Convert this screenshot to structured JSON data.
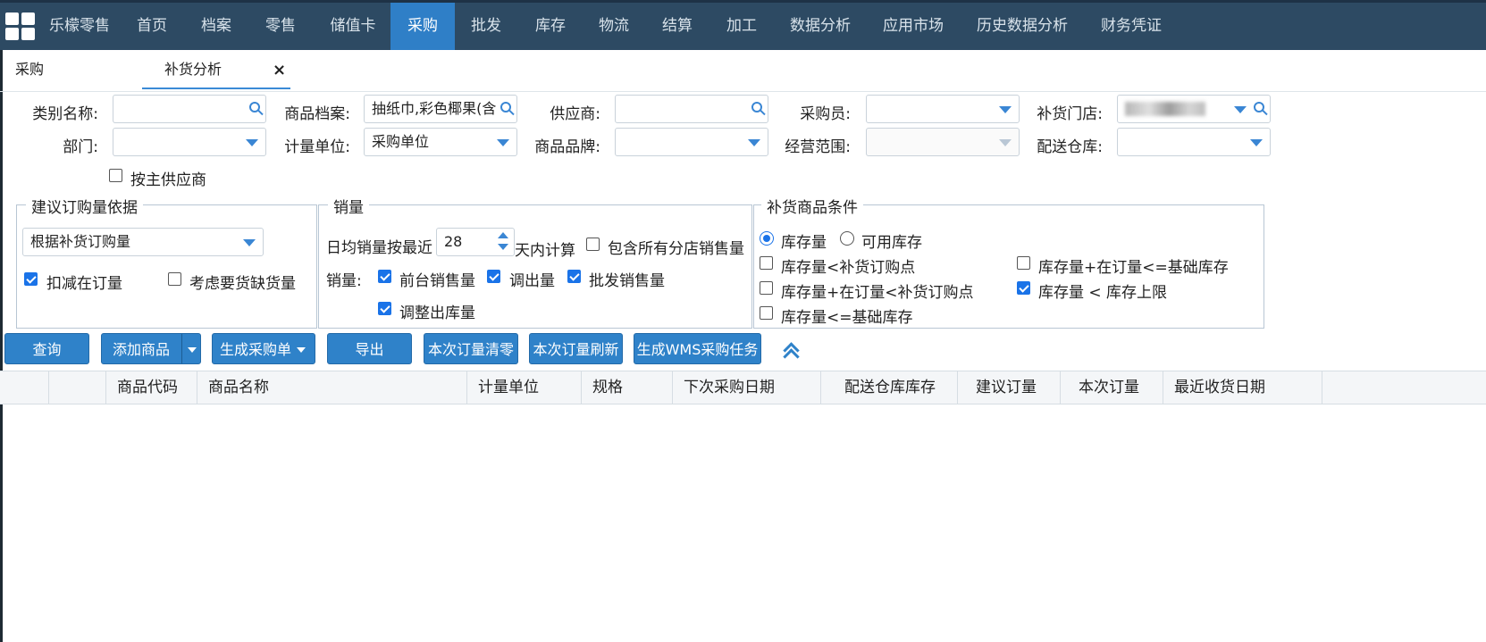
{
  "nav": {
    "brand": "乐檬零售",
    "items": [
      "首页",
      "档案",
      "零售",
      "储值卡",
      "采购",
      "批发",
      "库存",
      "物流",
      "结算",
      "加工",
      "数据分析",
      "应用市场",
      "历史数据分析",
      "财务凭证"
    ],
    "active": "采购"
  },
  "tabs": {
    "parent": "采购",
    "current": "补货分析",
    "close": "×"
  },
  "filters": {
    "category_label": "类别名称:",
    "category_value": "",
    "product_label": "商品档案:",
    "product_value": "抽纸巾,彩色椰果(含",
    "supplier_label": "供应商:",
    "supplier_value": "",
    "buyer_label": "采购员:",
    "buyer_value": "",
    "store_label": "补货门店:",
    "dept_label": "部门:",
    "dept_value": "",
    "unit_label": "计量单位:",
    "unit_value": "采购单位",
    "brand_label": "商品品牌:",
    "brand_value": "",
    "scope_label": "经营范围:",
    "scope_value": "",
    "warehouse_label": "配送仓库:",
    "warehouse_value": "",
    "main_supplier_label": "按主供应商",
    "main_supplier_checked": false
  },
  "basis": {
    "legend": "建议订购量依据",
    "select_value": "根据补货订购量",
    "deduct_label": "扣减在订量",
    "deduct_checked": true,
    "shortage_label": "考虑要货缺货量",
    "shortage_checked": false
  },
  "sales": {
    "legend": "销量",
    "avg_prefix": "日均销量按最近",
    "days": "28",
    "avg_suffix": "天内计算",
    "include_all_label": "包含所有分店销售量",
    "include_all_checked": false,
    "qty_label": "销量:",
    "front_label": "前台销售量",
    "front_checked": true,
    "transfer_label": "调出量",
    "transfer_checked": true,
    "wholesale_label": "批发销售量",
    "wholesale_checked": true,
    "adjust_label": "调整出库量",
    "adjust_checked": true
  },
  "conditions": {
    "legend": "补货商品条件",
    "radio_stock": "库存量",
    "radio_available": "可用库存",
    "selected_radio": "库存量",
    "items": [
      {
        "label": "库存量<补货订购点",
        "checked": false
      },
      {
        "label": "库存量+在订量<=基础库存",
        "checked": false
      },
      {
        "label": "库存量+在订量<补货订购点",
        "checked": false
      },
      {
        "label": "库存量 < 库存上限",
        "checked": true
      },
      {
        "label": "库存量<=基础库存",
        "checked": false
      }
    ]
  },
  "toolbar": {
    "query": "查询",
    "add_product": "添加商品",
    "generate_po": "生成采购单",
    "export": "导出",
    "clear_qty": "本次订量清零",
    "refresh_qty": "本次订量刷新",
    "wms_task": "生成WMS采购任务"
  },
  "table": {
    "columns": [
      "",
      "",
      "商品代码",
      "商品名称",
      "计量单位",
      "规格",
      "下次采购日期",
      "配送仓库库存",
      "建议订量",
      "本次订量",
      "最近收货日期"
    ]
  },
  "colors": {
    "nav_bg": "#2d4a63",
    "nav_active": "#2f7fc7",
    "button_bg": "#2f82c9",
    "checkbox_blue": "#1a73e8"
  }
}
